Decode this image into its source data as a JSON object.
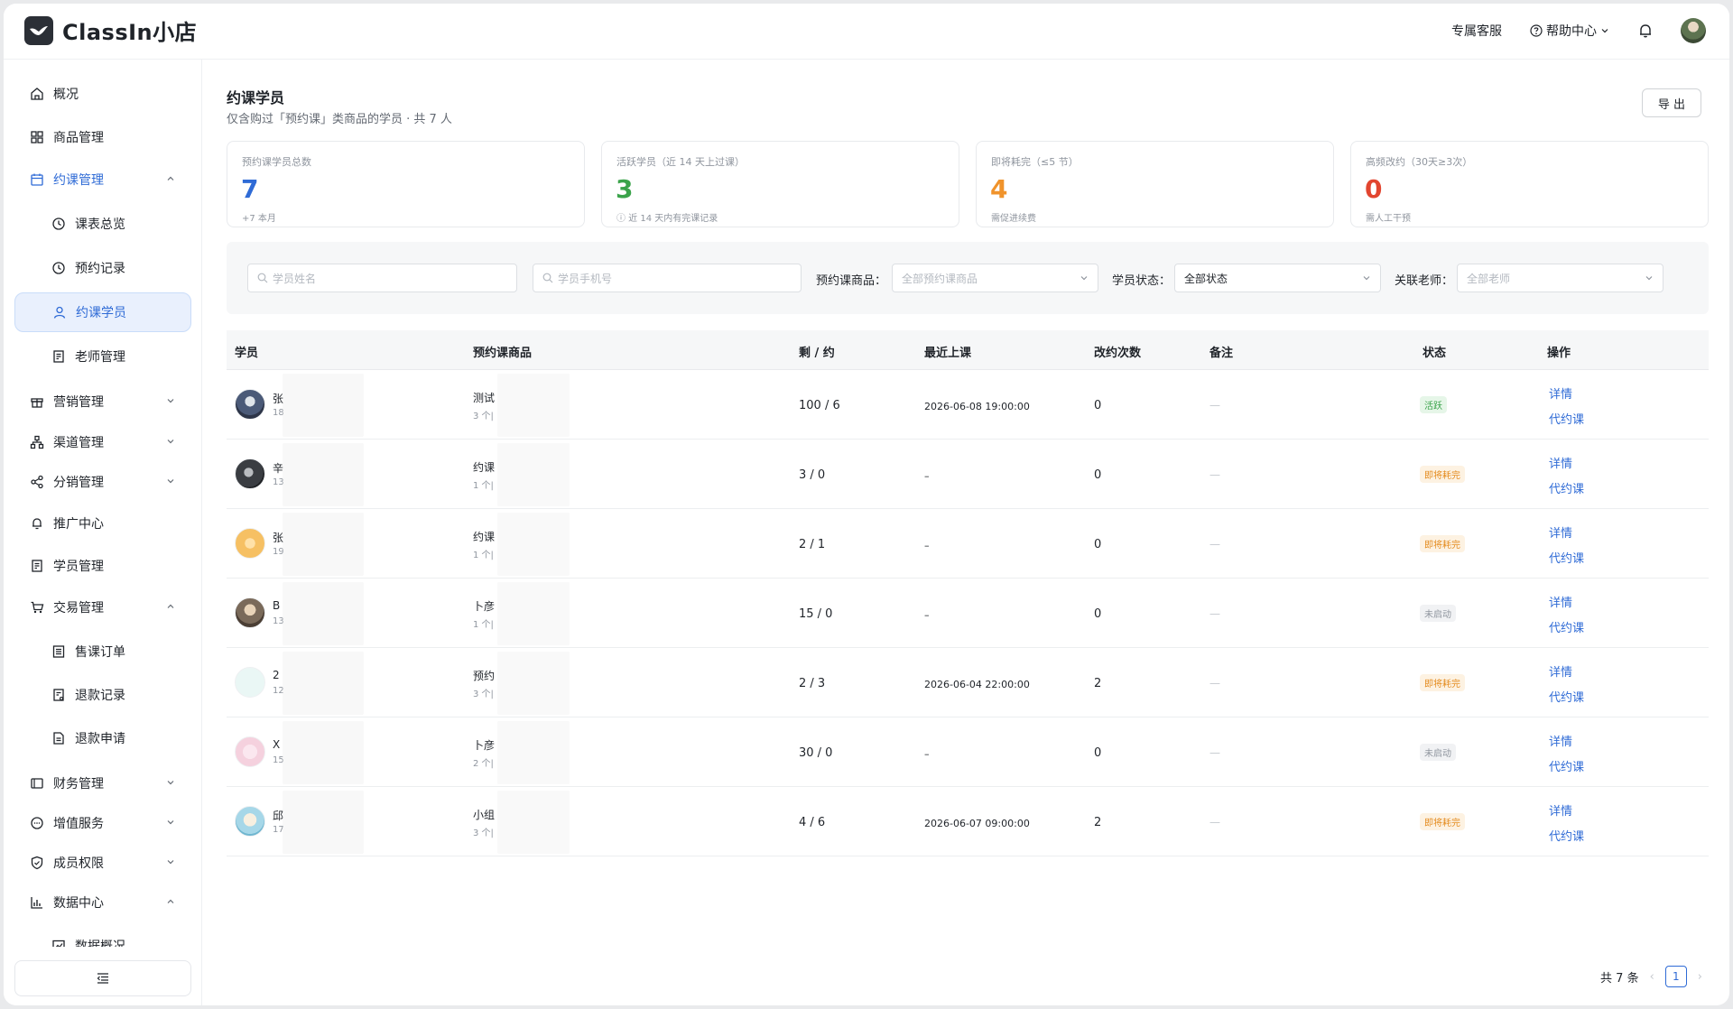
{
  "app": {
    "title": "ClassIn小店"
  },
  "header": {
    "service": "专属客服",
    "help": "帮助中心"
  },
  "sidebar": {
    "items": [
      {
        "label": "概况",
        "icon": "home-icon"
      },
      {
        "label": "商品管理",
        "icon": "grid-icon"
      },
      {
        "label": "约课管理",
        "icon": "calendar-icon"
      },
      {
        "label": "课表总览",
        "icon": "clock-icon"
      },
      {
        "label": "预约记录",
        "icon": "clock-icon"
      },
      {
        "label": "约课学员",
        "icon": "user-icon"
      },
      {
        "label": "老师管理",
        "icon": "doc-icon"
      },
      {
        "label": "营销管理",
        "icon": "gift-icon"
      },
      {
        "label": "渠道管理",
        "icon": "channel-icon"
      },
      {
        "label": "分销管理",
        "icon": "share-icon"
      },
      {
        "label": "推广中心",
        "icon": "bell-icon"
      },
      {
        "label": "学员管理",
        "icon": "doc-icon"
      },
      {
        "label": "交易管理",
        "icon": "cart-icon"
      },
      {
        "label": "售课订单",
        "icon": "list-icon"
      },
      {
        "label": "退款记录",
        "icon": "doc-icon"
      },
      {
        "label": "退款申请",
        "icon": "file-icon"
      },
      {
        "label": "财务管理",
        "icon": "wallet-icon"
      },
      {
        "label": "增值服务",
        "icon": "chat-icon"
      },
      {
        "label": "成员权限",
        "icon": "shield-icon"
      },
      {
        "label": "数据中心",
        "icon": "chart-icon"
      },
      {
        "label": "数据概况",
        "icon": "trend-icon"
      }
    ]
  },
  "page": {
    "title": "约课学员",
    "subtitle": "仅含购过「预约课」类商品的学员 · 共 7 人",
    "export": "导 出"
  },
  "stats": [
    {
      "label": "预约课学员总数",
      "value": "7",
      "note": "+7 本月",
      "color": "#2f6bd6"
    },
    {
      "label": "活跃学员（近 14 天上过课）",
      "value": "3",
      "note": "ⓘ 近 14 天内有完课记录",
      "color": "#3aa34a"
    },
    {
      "label": "即将耗完（≤5 节）",
      "value": "4",
      "note": "需促进续费",
      "color": "#f0932b"
    },
    {
      "label": "高频改约（30天≥3次）",
      "value": "0",
      "note": "需人工干预",
      "color": "#e2452f"
    }
  ],
  "filters": {
    "name_placeholder": "学员姓名",
    "phone_placeholder": "学员手机号",
    "product_label": "预约课商品：",
    "product_placeholder": "全部预约课商品",
    "status_label": "学员状态：",
    "status_value": "全部状态",
    "teacher_label": "关联老师：",
    "teacher_placeholder": "全部老师"
  },
  "table": {
    "headers": [
      "学员",
      "预约课商品",
      "剩 / 约",
      "最近上课",
      "改约次数",
      "备注",
      "状态",
      "操作"
    ],
    "rows": [
      {
        "name": "张",
        "phone": "18",
        "product": "测试",
        "product_sub": "3 个|",
        "remaining": "100 / 6",
        "last": "2026-06-08 19:00:00",
        "changes": "0",
        "memo": "—",
        "status": "活跃",
        "status_type": "active"
      },
      {
        "name": "辛",
        "phone": "13",
        "product": "约课",
        "product_sub": "1 个|",
        "remaining": "3 / 0",
        "last": "–",
        "changes": "0",
        "memo": "—",
        "status": "即将耗完",
        "status_type": "warn"
      },
      {
        "name": "张",
        "phone": "19",
        "product": "约课",
        "product_sub": "1 个|",
        "remaining": "2 / 1",
        "last": "–",
        "changes": "0",
        "memo": "—",
        "status": "即将耗完",
        "status_type": "warn"
      },
      {
        "name": "B",
        "phone": "13",
        "product": "卜彦",
        "product_sub": "1 个|",
        "remaining": "15 / 0",
        "last": "–",
        "changes": "0",
        "memo": "—",
        "status": "未启动",
        "status_type": "idle"
      },
      {
        "name": "2",
        "phone": "12",
        "product": "预约",
        "product_sub": "3 个|",
        "remaining": "2 / 3",
        "last": "2026-06-04 22:00:00",
        "changes": "2",
        "memo": "—",
        "status": "即将耗完",
        "status_type": "warn"
      },
      {
        "name": "X",
        "phone": "15",
        "product": "卜彦",
        "product_sub": "2 个|",
        "remaining": "30 / 0",
        "last": "–",
        "changes": "0",
        "memo": "—",
        "status": "未启动",
        "status_type": "idle"
      },
      {
        "name": "邱",
        "phone": "17",
        "product": "小组",
        "product_sub": "3 个|",
        "remaining": "4 / 6",
        "last": "2026-06-07 09:00:00",
        "changes": "2",
        "memo": "—",
        "status": "即将耗完",
        "status_type": "warn"
      }
    ],
    "op_detail": "详情",
    "op_book": "代约课"
  },
  "pager": {
    "total": "共 7 条",
    "page": "1"
  }
}
